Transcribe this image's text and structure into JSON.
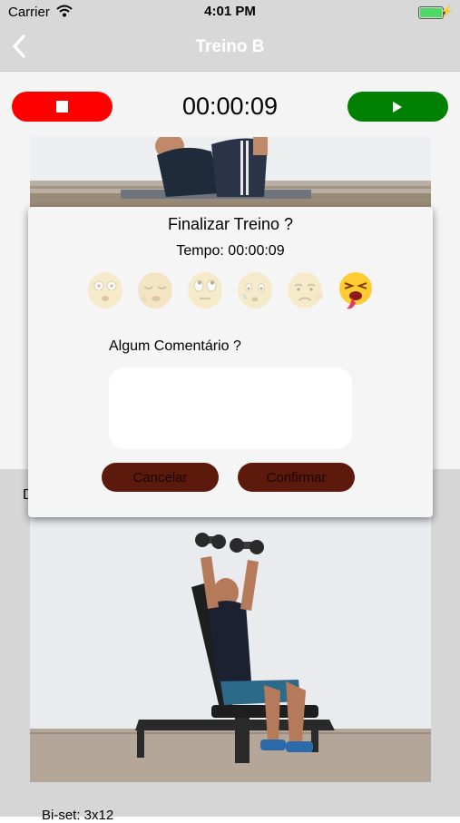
{
  "status_bar": {
    "carrier": "Carrier",
    "time": "4:01 PM"
  },
  "nav": {
    "title": "Treino B",
    "back_icon": "chevron-left-icon"
  },
  "timer": {
    "stop_color": "#ff0000",
    "play_color": "#008000",
    "elapsed": "00:00:09"
  },
  "background": {
    "peek_letter": "D",
    "exercise_label": "Bi-set: 3x12"
  },
  "modal": {
    "title": "Finalizar Treino ?",
    "time_label": "Tempo: 00:00:09",
    "mood_icons": [
      "dizzy-face-icon",
      "sleepy-face-icon",
      "rolling-eyes-face-icon",
      "worried-face-icon",
      "sad-face-icon",
      "exhausted-face-icon"
    ],
    "selected_mood_index": 5,
    "comment_label": "Algum Comentário ?",
    "comment_value": "",
    "comment_placeholder": "",
    "cancel_label": "Cancelar",
    "confirm_label": "Confirmar",
    "button_color": "#5c1a0d"
  }
}
